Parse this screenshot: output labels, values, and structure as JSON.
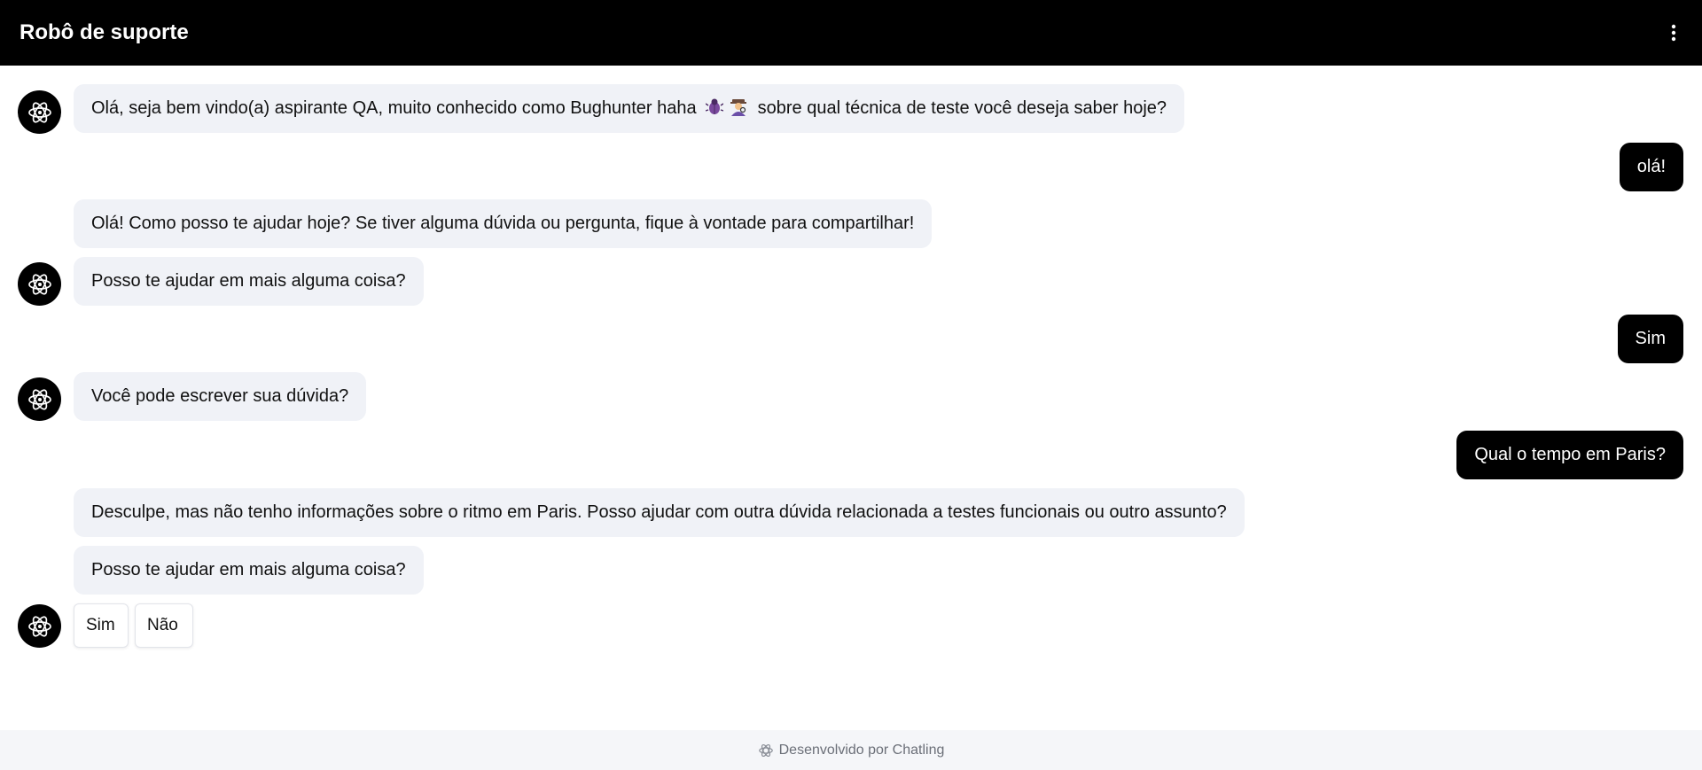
{
  "header": {
    "title": "Robô de suporte",
    "menu_icon": "kebab-menu-icon"
  },
  "messages": [
    {
      "role": "bot",
      "text_before": "Olá, seja bem vindo(a) aspirante QA, muito conhecido como Bughunter haha",
      "emojis": [
        "bug",
        "detective"
      ],
      "text_after": "sobre qual técnica de teste você deseja saber hoje?"
    },
    {
      "role": "user",
      "text": "olá!"
    },
    {
      "role": "bot",
      "text": "Olá! Como posso te ajudar hoje? Se tiver alguma dúvida ou pergunta, fique à vontade para compartilhar!"
    },
    {
      "role": "bot",
      "text": "Posso te ajudar em mais alguma coisa?"
    },
    {
      "role": "user",
      "text": "Sim"
    },
    {
      "role": "bot",
      "text": "Você pode escrever sua dúvida?"
    },
    {
      "role": "user",
      "text": "Qual o tempo em Paris?"
    },
    {
      "role": "bot",
      "text": "Desculpe, mas não tenho informações sobre o ritmo em Paris. Posso ajudar com outra dúvida relacionada a testes funcionais ou outro assunto?"
    },
    {
      "role": "bot",
      "text": "Posso te ajudar em mais alguma coisa?"
    }
  ],
  "quick_replies": [
    "Sim",
    "Não"
  ],
  "footer": {
    "text": "Desenvolvido por Chatling",
    "icon": "chatling-logo-icon"
  },
  "colors": {
    "header_bg": "#000000",
    "bot_bubble_bg": "#f0f2f7",
    "user_bubble_bg": "#000000",
    "footer_bg": "#f5f6f9"
  }
}
